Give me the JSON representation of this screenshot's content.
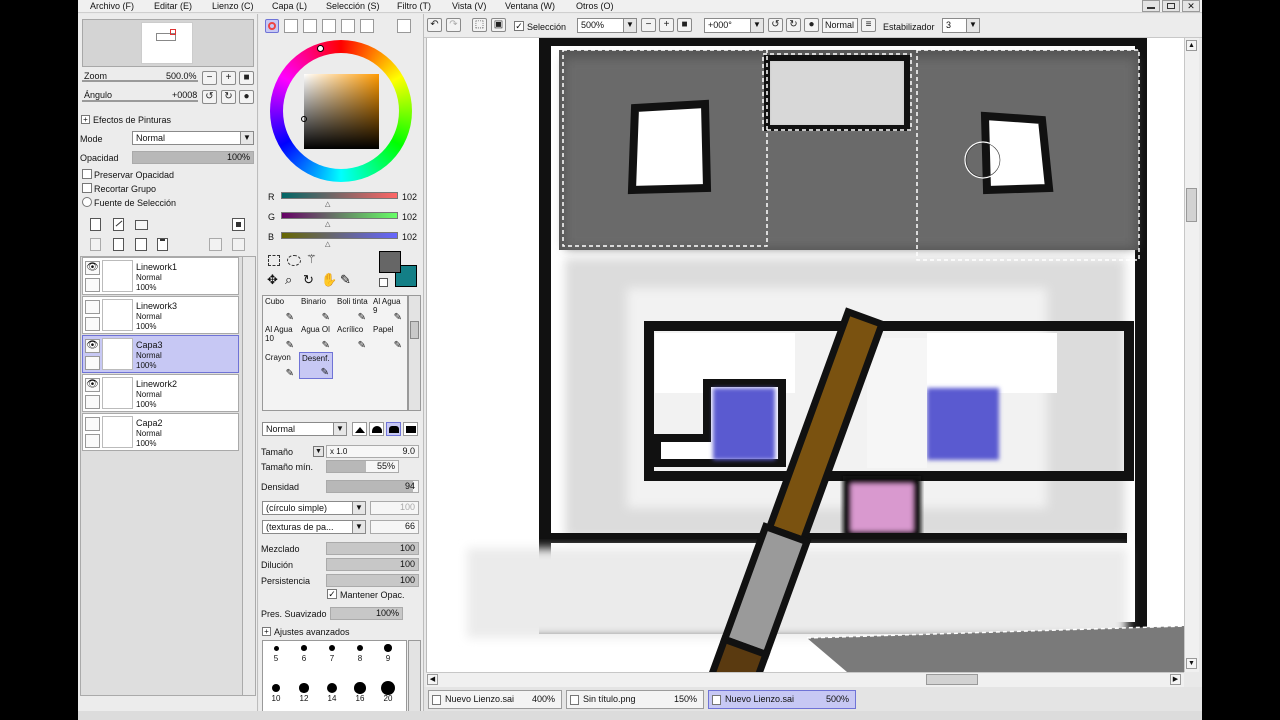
{
  "menu": [
    "Archivo (F)",
    "Editar (E)",
    "Lienzo (C)",
    "Capa (L)",
    "Selección (S)",
    "Filtro (T)",
    "Vista (V)",
    "Ventana (W)",
    "Otros (O)"
  ],
  "navigator": {
    "zoom_label": "Zoom",
    "zoom_value": "500.0%",
    "angle_label": "Ángulo",
    "angle_value": "+0008"
  },
  "paint_effects": {
    "title": "Efectos de Pinturas",
    "mode_label": "Mode",
    "mode_value": "Normal",
    "opacity_label": "Opacidad",
    "opacity_value": "100%",
    "opacity_fraction": 1.0,
    "preserve_opacity": "Preservar Opacidad",
    "clip_group": "Recortar Grupo",
    "selection_source": "Fuente de Selección"
  },
  "layers": [
    {
      "name": "Linework1",
      "mode": "Normal",
      "opacity": "100%",
      "selected": false,
      "visible": true
    },
    {
      "name": "Linework3",
      "mode": "Normal",
      "opacity": "100%",
      "selected": false,
      "visible": false
    },
    {
      "name": "Capa3",
      "mode": "Normal",
      "opacity": "100%",
      "selected": true,
      "visible": true
    },
    {
      "name": "Linework2",
      "mode": "Normal",
      "opacity": "100%",
      "selected": false,
      "visible": true
    },
    {
      "name": "Capa2",
      "mode": "Normal",
      "opacity": "100%",
      "selected": false,
      "visible": false
    }
  ],
  "color": {
    "r_label": "R",
    "r_value": "102",
    "g_label": "G",
    "g_value": "102",
    "b_label": "B",
    "b_value": "102",
    "primary": "#666666",
    "secondary": "#137f86"
  },
  "brushes": [
    {
      "name": "Cubo",
      "selected": false
    },
    {
      "name": "Binario",
      "selected": false
    },
    {
      "name": "Boli tinta",
      "selected": false
    },
    {
      "name": "Al Agua 9",
      "selected": false
    },
    {
      "name": "Al Agua 10",
      "selected": false
    },
    {
      "name": "Agua Ol",
      "selected": false
    },
    {
      "name": "Acrílico",
      "selected": false
    },
    {
      "name": "Papel",
      "selected": false
    },
    {
      "name": "Crayon",
      "selected": false
    },
    {
      "name": "Desenf.",
      "selected": true
    }
  ],
  "brush_settings": {
    "blend_mode": "Normal",
    "size_label": "Tamaño",
    "size_mult": "x 1.0",
    "size_value": "9.0",
    "min_size_label": "Tamaño mín.",
    "min_size_value": "55%",
    "min_size_fraction": 0.55,
    "density_label": "Densidad",
    "density_value": "94",
    "density_fraction": 0.94,
    "shape_select": "(círculo simple)",
    "shape_value": "100",
    "texture_select": "(texturas de pa...",
    "texture_value": "66",
    "blend_label": "Mezclado",
    "blend_value": "100",
    "dilution_label": "Dilución",
    "dilution_value": "100",
    "persistence_label": "Persistencia",
    "persistence_value": "100",
    "keep_opacity": "Mantener Opac.",
    "smoothing_label": "Pres. Suavizado",
    "smoothing_value": "100%",
    "advanced": "Ajustes avanzados"
  },
  "brush_sizes_row1": [
    "5",
    "6",
    "7",
    "8",
    "9"
  ],
  "brush_sizes_row2": [
    "10",
    "12",
    "14",
    "16",
    "20"
  ],
  "toolbar": {
    "selection_label": "Selección",
    "zoom_value": "500%",
    "angle_value": "+000°",
    "mode_value": "Normal",
    "stabilizer_label": "Estabilizador",
    "stabilizer_value": "3"
  },
  "documents": [
    {
      "name": "Nuevo Lienzo.sai",
      "zoom": "400%",
      "active": false
    },
    {
      "name": "Sin título.png",
      "zoom": "150%",
      "active": false
    },
    {
      "name": "Nuevo Lienzo.sai",
      "zoom": "500%",
      "active": true
    }
  ]
}
